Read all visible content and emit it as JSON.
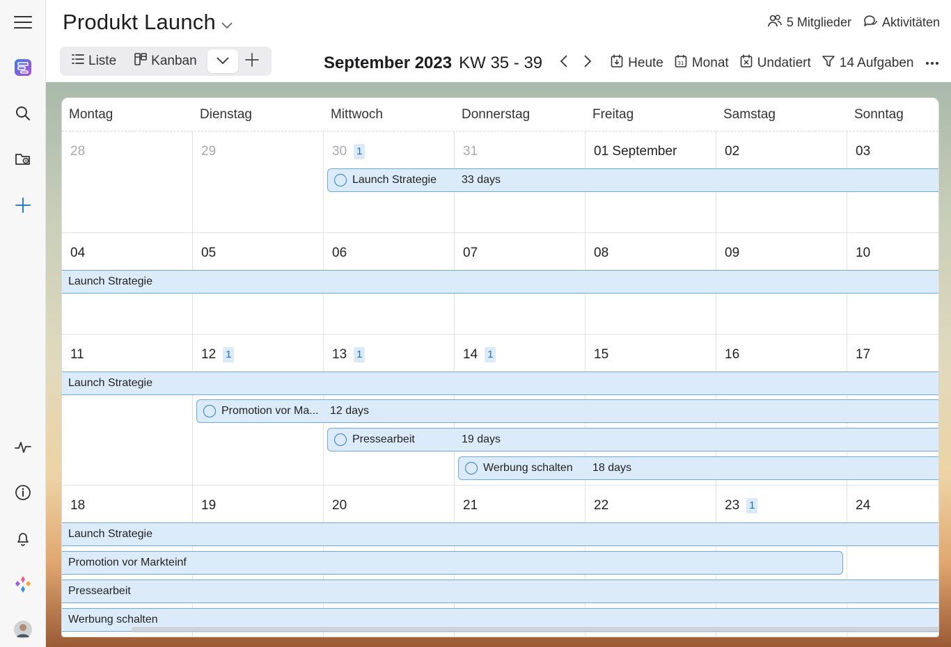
{
  "project": {
    "title": "Produkt Launch"
  },
  "header": {
    "members": "5 Mitglieder",
    "activities": "Aktivitäten"
  },
  "views": {
    "list": "Liste",
    "kanban": "Kanban"
  },
  "calendar": {
    "month": "September 2023",
    "week_range": "KW 35 - 39",
    "today": "Heute",
    "month_view": "Monat",
    "undated": "Undatiert",
    "filter": "14 Aufgaben"
  },
  "weekdays": [
    "Montag",
    "Dienstag",
    "Mittwoch",
    "Donnerstag",
    "Freitag",
    "Samstag",
    "Sonntag"
  ],
  "weeks": [
    {
      "days": [
        "28",
        "29",
        "30",
        "31",
        "01 September",
        "02",
        "03"
      ],
      "badges": {
        "30": "1"
      }
    },
    {
      "days": [
        "04",
        "05",
        "06",
        "07",
        "08",
        "09",
        "10"
      ],
      "badges": {}
    },
    {
      "days": [
        "11",
        "12",
        "13",
        "14",
        "15",
        "16",
        "17"
      ],
      "badges": {
        "12": "1",
        "13": "1",
        "14": "1"
      }
    },
    {
      "days": [
        "18",
        "19",
        "20",
        "21",
        "22",
        "23",
        "24"
      ],
      "badges": {
        "23": "1"
      }
    }
  ],
  "tasks": {
    "launch": {
      "name": "Launch Strategie",
      "duration": "33 days"
    },
    "promotion": {
      "name": "Promotion vor Ma...",
      "full_name": "Promotion vor Markteinf",
      "duration": "12 days"
    },
    "press": {
      "name": "Pressearbeit",
      "duration": "19 days"
    },
    "ads": {
      "name": "Werbung schalten",
      "duration": "18 days"
    }
  },
  "colors": {
    "accent": "#2f7cc6",
    "bar_fill": "#dcebfa",
    "bar_border": "#6fa9df",
    "badge_bg": "#dbe9f8"
  },
  "icons": [
    "menu-icon",
    "app-logo-icon",
    "search-icon",
    "folder-icon",
    "plus-icon",
    "activity-icon",
    "info-icon",
    "bell-icon",
    "sparkle-icon",
    "avatar"
  ]
}
